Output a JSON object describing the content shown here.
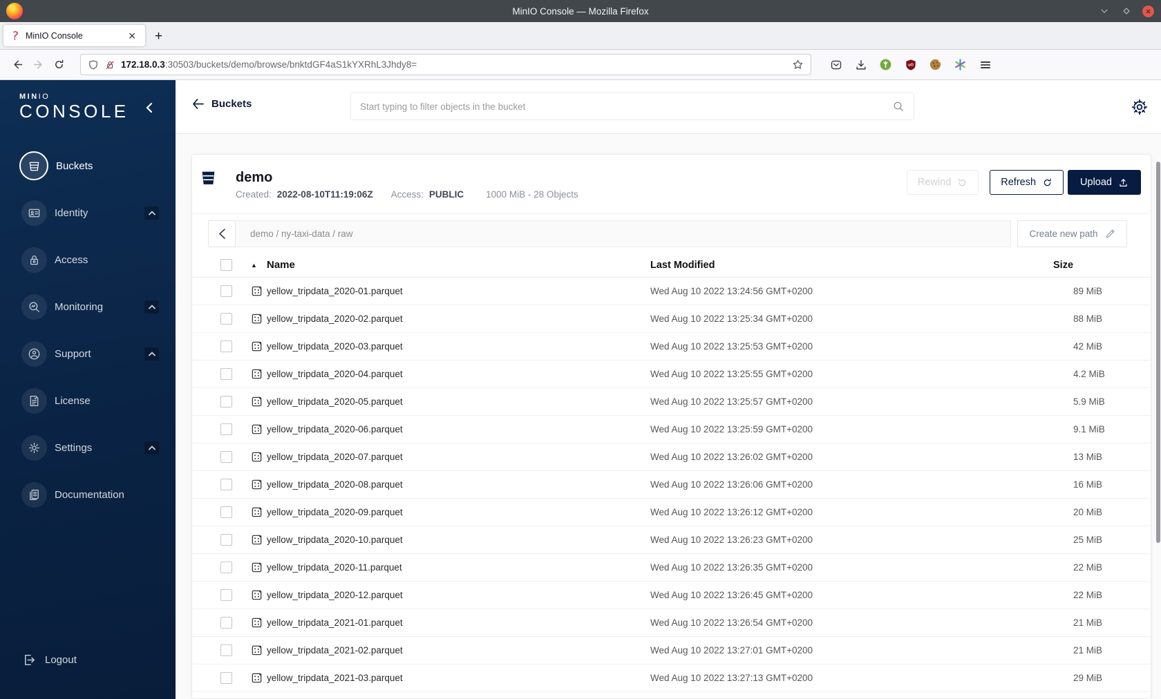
{
  "colors": {
    "accent": "#081C42",
    "sidebar_top": "#0e2e54",
    "sidebar_bottom": "#081d3a",
    "close_button": "#e2574c"
  },
  "browser": {
    "window_title": "MinIO Console — Mozilla Firefox",
    "tab_title": "MinIO Console",
    "new_tab_label": "+",
    "url_host": "172.18.0.3",
    "url_rest": ":30503/buckets/demo/browse/bnktdGF4aS1kYXRhL3Jhdy8="
  },
  "sidebar": {
    "brand_bold": "MIN",
    "brand_light": "IO",
    "product": "CONSOLE",
    "items": [
      {
        "label": "Buckets",
        "icon": "bucket-icon",
        "active": true,
        "expandable": false
      },
      {
        "label": "Identity",
        "icon": "identity-icon",
        "active": false,
        "expandable": true
      },
      {
        "label": "Access",
        "icon": "access-icon",
        "active": false,
        "expandable": false
      },
      {
        "label": "Monitoring",
        "icon": "monitoring-icon",
        "active": false,
        "expandable": true
      },
      {
        "label": "Support",
        "icon": "support-icon",
        "active": false,
        "expandable": true
      },
      {
        "label": "License",
        "icon": "license-icon",
        "active": false,
        "expandable": false
      },
      {
        "label": "Settings",
        "icon": "settings-icon",
        "active": false,
        "expandable": true
      },
      {
        "label": "Documentation",
        "icon": "documentation-icon",
        "active": false,
        "expandable": false
      }
    ],
    "logout_label": "Logout"
  },
  "topbar": {
    "back_label": "Buckets",
    "search_placeholder": "Start typing to filter objects in the bucket"
  },
  "bucket": {
    "name": "demo",
    "created_label": "Created:",
    "created_value": "2022-08-10T11:19:06Z",
    "access_label": "Access:",
    "access_value": "PUBLIC",
    "usage": "1000 MiB - 28 Objects",
    "rewind_label": "Rewind",
    "refresh_label": "Refresh",
    "upload_label": "Upload"
  },
  "browse": {
    "breadcrumb": "demo / ny-taxi-data / raw",
    "create_path_label": "Create new path"
  },
  "objects": {
    "columns": {
      "name": "Name",
      "last_modified": "Last Modified",
      "size": "Size"
    },
    "rows": [
      {
        "name": "yellow_tripdata_2020-01.parquet",
        "modified": "Wed Aug 10 2022 13:24:56 GMT+0200",
        "size": "89 MiB"
      },
      {
        "name": "yellow_tripdata_2020-02.parquet",
        "modified": "Wed Aug 10 2022 13:25:34 GMT+0200",
        "size": "88 MiB"
      },
      {
        "name": "yellow_tripdata_2020-03.parquet",
        "modified": "Wed Aug 10 2022 13:25:53 GMT+0200",
        "size": "42 MiB"
      },
      {
        "name": "yellow_tripdata_2020-04.parquet",
        "modified": "Wed Aug 10 2022 13:25:55 GMT+0200",
        "size": "4.2 MiB"
      },
      {
        "name": "yellow_tripdata_2020-05.parquet",
        "modified": "Wed Aug 10 2022 13:25:57 GMT+0200",
        "size": "5.9 MiB"
      },
      {
        "name": "yellow_tripdata_2020-06.parquet",
        "modified": "Wed Aug 10 2022 13:25:59 GMT+0200",
        "size": "9.1 MiB"
      },
      {
        "name": "yellow_tripdata_2020-07.parquet",
        "modified": "Wed Aug 10 2022 13:26:02 GMT+0200",
        "size": "13 MiB"
      },
      {
        "name": "yellow_tripdata_2020-08.parquet",
        "modified": "Wed Aug 10 2022 13:26:06 GMT+0200",
        "size": "16 MiB"
      },
      {
        "name": "yellow_tripdata_2020-09.parquet",
        "modified": "Wed Aug 10 2022 13:26:12 GMT+0200",
        "size": "20 MiB"
      },
      {
        "name": "yellow_tripdata_2020-10.parquet",
        "modified": "Wed Aug 10 2022 13:26:23 GMT+0200",
        "size": "25 MiB"
      },
      {
        "name": "yellow_tripdata_2020-11.parquet",
        "modified": "Wed Aug 10 2022 13:26:35 GMT+0200",
        "size": "22 MiB"
      },
      {
        "name": "yellow_tripdata_2020-12.parquet",
        "modified": "Wed Aug 10 2022 13:26:45 GMT+0200",
        "size": "22 MiB"
      },
      {
        "name": "yellow_tripdata_2021-01.parquet",
        "modified": "Wed Aug 10 2022 13:26:54 GMT+0200",
        "size": "21 MiB"
      },
      {
        "name": "yellow_tripdata_2021-02.parquet",
        "modified": "Wed Aug 10 2022 13:27:01 GMT+0200",
        "size": "21 MiB"
      },
      {
        "name": "yellow_tripdata_2021-03.parquet",
        "modified": "Wed Aug 10 2022 13:27:13 GMT+0200",
        "size": "29 MiB"
      }
    ]
  }
}
